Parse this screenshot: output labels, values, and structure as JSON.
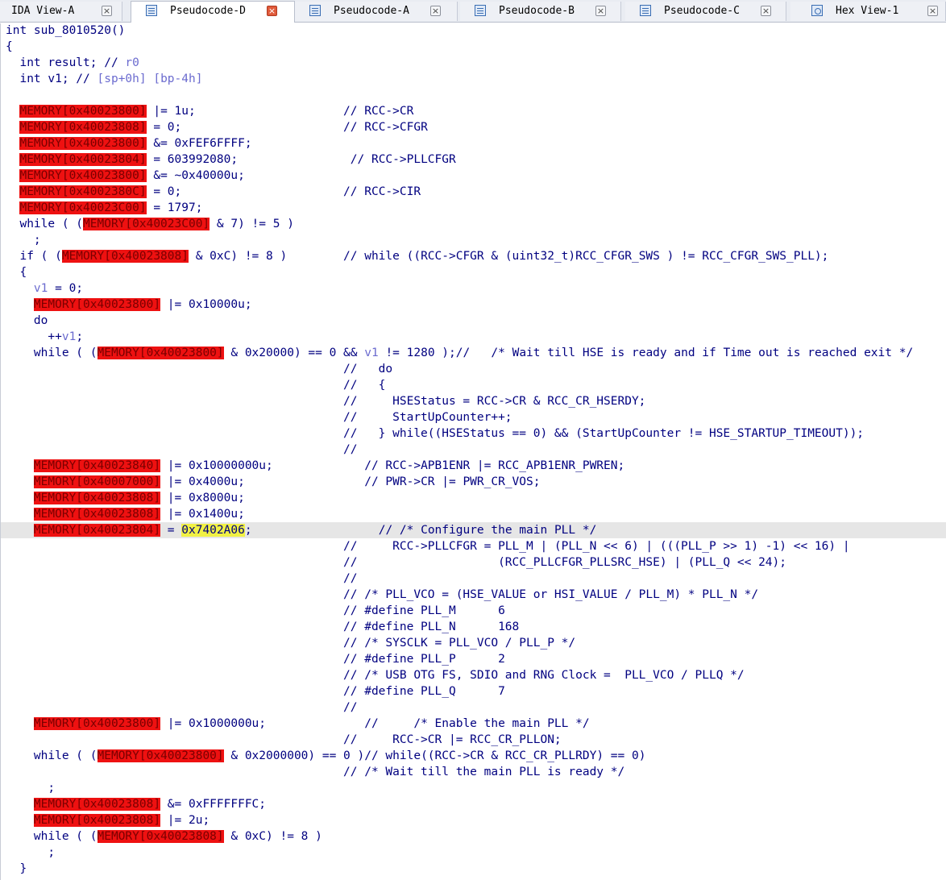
{
  "tabs": [
    {
      "label": "IDA View-A",
      "icon": "none",
      "active": false
    },
    {
      "label": "Pseudocode-D",
      "icon": "pseudocode-icon",
      "active": true
    },
    {
      "label": "Pseudocode-A",
      "icon": "pseudocode-icon",
      "active": false
    },
    {
      "label": "Pseudocode-B",
      "icon": "pseudocode-icon",
      "active": false
    },
    {
      "label": "Pseudocode-C",
      "icon": "pseudocode-icon",
      "active": false
    },
    {
      "label": "Hex View-1",
      "icon": "hex-view-icon",
      "active": false
    }
  ],
  "close_glyph": "×",
  "lines": [
    {
      "current": false,
      "segs": [
        {
          "t": "int sub_8010520()",
          "c": "t"
        }
      ]
    },
    {
      "current": false,
      "segs": [
        {
          "t": "{",
          "c": "t"
        }
      ]
    },
    {
      "current": false,
      "segs": [
        {
          "t": "  int result; // ",
          "c": "t"
        },
        {
          "t": "r0",
          "c": "var"
        }
      ]
    },
    {
      "current": false,
      "segs": [
        {
          "t": "  int v1; // ",
          "c": "t"
        },
        {
          "t": "[sp+0h] [bp-4h]",
          "c": "var"
        }
      ]
    },
    {
      "current": false,
      "segs": []
    },
    {
      "current": false,
      "segs": [
        {
          "t": "  ",
          "c": "t"
        },
        {
          "t": "MEMORY[0x40023800]",
          "c": "mem"
        },
        {
          "t": " |= 1u;                     // RCC->CR",
          "c": "t"
        }
      ]
    },
    {
      "current": false,
      "segs": [
        {
          "t": "  ",
          "c": "t"
        },
        {
          "t": "MEMORY[0x40023808]",
          "c": "mem"
        },
        {
          "t": " = 0;                       // RCC->CFGR",
          "c": "t"
        }
      ]
    },
    {
      "current": false,
      "segs": [
        {
          "t": "  ",
          "c": "t"
        },
        {
          "t": "MEMORY[0x40023800]",
          "c": "mem"
        },
        {
          "t": " &= 0xFEF6FFFF;",
          "c": "t"
        }
      ]
    },
    {
      "current": false,
      "segs": [
        {
          "t": "  ",
          "c": "t"
        },
        {
          "t": "MEMORY[0x40023804]",
          "c": "mem"
        },
        {
          "t": " = 603992080;                // RCC->PLLCFGR",
          "c": "t"
        }
      ]
    },
    {
      "current": false,
      "segs": [
        {
          "t": "  ",
          "c": "t"
        },
        {
          "t": "MEMORY[0x40023800]",
          "c": "mem"
        },
        {
          "t": " &= ~0x40000u;",
          "c": "t"
        }
      ]
    },
    {
      "current": false,
      "segs": [
        {
          "t": "  ",
          "c": "t"
        },
        {
          "t": "MEMORY[0x4002380C]",
          "c": "mem"
        },
        {
          "t": " = 0;                       // RCC->CIR",
          "c": "t"
        }
      ]
    },
    {
      "current": false,
      "segs": [
        {
          "t": "  ",
          "c": "t"
        },
        {
          "t": "MEMORY[0x40023C00]",
          "c": "mem"
        },
        {
          "t": " = 1797;",
          "c": "t"
        }
      ]
    },
    {
      "current": false,
      "segs": [
        {
          "t": "  while ( (",
          "c": "t"
        },
        {
          "t": "MEMORY[0x40023C00]",
          "c": "mem"
        },
        {
          "t": " & 7) != 5 )",
          "c": "t"
        }
      ]
    },
    {
      "current": false,
      "segs": [
        {
          "t": "    ;",
          "c": "t"
        }
      ]
    },
    {
      "current": false,
      "segs": [
        {
          "t": "  if ( (",
          "c": "t"
        },
        {
          "t": "MEMORY[0x40023808]",
          "c": "mem"
        },
        {
          "t": " & 0xC) != 8 )        // while ((RCC->CFGR & (uint32_t)RCC_CFGR_SWS ) != RCC_CFGR_SWS_PLL);",
          "c": "t"
        }
      ]
    },
    {
      "current": false,
      "segs": [
        {
          "t": "  {",
          "c": "t"
        }
      ]
    },
    {
      "current": false,
      "segs": [
        {
          "t": "    ",
          "c": "t"
        },
        {
          "t": "v1",
          "c": "var"
        },
        {
          "t": " = 0;",
          "c": "t"
        }
      ]
    },
    {
      "current": false,
      "segs": [
        {
          "t": "    ",
          "c": "t"
        },
        {
          "t": "MEMORY[0x40023800]",
          "c": "mem"
        },
        {
          "t": " |= 0x10000u;",
          "c": "t"
        }
      ]
    },
    {
      "current": false,
      "segs": [
        {
          "t": "    do",
          "c": "t"
        }
      ]
    },
    {
      "current": false,
      "segs": [
        {
          "t": "      ++",
          "c": "t"
        },
        {
          "t": "v1",
          "c": "var"
        },
        {
          "t": ";",
          "c": "t"
        }
      ]
    },
    {
      "current": false,
      "segs": [
        {
          "t": "    while ( (",
          "c": "t"
        },
        {
          "t": "MEMORY[0x40023800]",
          "c": "mem"
        },
        {
          "t": " & 0x20000) == 0 && ",
          "c": "t"
        },
        {
          "t": "v1",
          "c": "var"
        },
        {
          "t": " != 1280 );//   /* Wait till HSE is ready and if Time out is reached exit */",
          "c": "t"
        }
      ]
    },
    {
      "current": false,
      "segs": [
        {
          "t": "                                                //   do",
          "c": "t"
        }
      ]
    },
    {
      "current": false,
      "segs": [
        {
          "t": "                                                //   {",
          "c": "t"
        }
      ]
    },
    {
      "current": false,
      "segs": [
        {
          "t": "                                                //     HSEStatus = RCC->CR & RCC_CR_HSERDY;",
          "c": "t"
        }
      ]
    },
    {
      "current": false,
      "segs": [
        {
          "t": "                                                //     StartUpCounter++;",
          "c": "t"
        }
      ]
    },
    {
      "current": false,
      "segs": [
        {
          "t": "                                                //   } while((HSEStatus == 0) && (StartUpCounter != HSE_STARTUP_TIMEOUT));",
          "c": "t"
        }
      ]
    },
    {
      "current": false,
      "segs": [
        {
          "t": "                                                //",
          "c": "t"
        }
      ]
    },
    {
      "current": false,
      "segs": [
        {
          "t": "    ",
          "c": "t"
        },
        {
          "t": "MEMORY[0x40023840]",
          "c": "mem"
        },
        {
          "t": " |= 0x10000000u;             // RCC->APB1ENR |= RCC_APB1ENR_PWREN;",
          "c": "t"
        }
      ]
    },
    {
      "current": false,
      "segs": [
        {
          "t": "    ",
          "c": "t"
        },
        {
          "t": "MEMORY[0x40007000]",
          "c": "mem"
        },
        {
          "t": " |= 0x4000u;                 // PWR->CR |= PWR_CR_VOS;",
          "c": "t"
        }
      ]
    },
    {
      "current": false,
      "segs": [
        {
          "t": "    ",
          "c": "t"
        },
        {
          "t": "MEMORY[0x40023808]",
          "c": "mem"
        },
        {
          "t": " |= 0x8000u;",
          "c": "t"
        }
      ]
    },
    {
      "current": false,
      "segs": [
        {
          "t": "    ",
          "c": "t"
        },
        {
          "t": "MEMORY[0x40023808]",
          "c": "mem"
        },
        {
          "t": " |= 0x1400u;",
          "c": "t"
        }
      ]
    },
    {
      "current": true,
      "segs": [
        {
          "t": "    ",
          "c": "t"
        },
        {
          "t": "MEMORY[0x40023804]",
          "c": "mem"
        },
        {
          "t": " = ",
          "c": "t"
        },
        {
          "t": "0x7402A06",
          "c": "hl"
        },
        {
          "t": ";                  // /* Configure the main PLL */",
          "c": "t"
        }
      ]
    },
    {
      "current": false,
      "segs": [
        {
          "t": "                                                //     RCC->PLLCFGR = PLL_M | (PLL_N << 6) | (((PLL_P >> 1) -1) << 16) |",
          "c": "t"
        }
      ]
    },
    {
      "current": false,
      "segs": [
        {
          "t": "                                                //                    (RCC_PLLCFGR_PLLSRC_HSE) | (PLL_Q << 24);",
          "c": "t"
        }
      ]
    },
    {
      "current": false,
      "segs": [
        {
          "t": "                                                //",
          "c": "t"
        }
      ]
    },
    {
      "current": false,
      "segs": [
        {
          "t": "                                                // /* PLL_VCO = (HSE_VALUE or HSI_VALUE / PLL_M) * PLL_N */",
          "c": "t"
        }
      ]
    },
    {
      "current": false,
      "segs": [
        {
          "t": "                                                // #define PLL_M      6",
          "c": "t"
        }
      ]
    },
    {
      "current": false,
      "segs": [
        {
          "t": "                                                // #define PLL_N      168",
          "c": "t"
        }
      ]
    },
    {
      "current": false,
      "segs": [
        {
          "t": "                                                // /* SYSCLK = PLL_VCO / PLL_P */",
          "c": "t"
        }
      ]
    },
    {
      "current": false,
      "segs": [
        {
          "t": "                                                // #define PLL_P      2",
          "c": "t"
        }
      ]
    },
    {
      "current": false,
      "segs": [
        {
          "t": "                                                // /* USB OTG FS, SDIO and RNG Clock =  PLL_VCO / PLLQ */",
          "c": "t"
        }
      ]
    },
    {
      "current": false,
      "segs": [
        {
          "t": "                                                // #define PLL_Q      7",
          "c": "t"
        }
      ]
    },
    {
      "current": false,
      "segs": [
        {
          "t": "                                                //",
          "c": "t"
        }
      ]
    },
    {
      "current": false,
      "segs": [
        {
          "t": "    ",
          "c": "t"
        },
        {
          "t": "MEMORY[0x40023800]",
          "c": "mem"
        },
        {
          "t": " |= 0x1000000u;              //     /* Enable the main PLL */",
          "c": "t"
        }
      ]
    },
    {
      "current": false,
      "segs": [
        {
          "t": "                                                //     RCC->CR |= RCC_CR_PLLON;",
          "c": "t"
        }
      ]
    },
    {
      "current": false,
      "segs": [
        {
          "t": "    while ( (",
          "c": "t"
        },
        {
          "t": "MEMORY[0x40023800]",
          "c": "mem"
        },
        {
          "t": " & 0x2000000) == 0 )// while((RCC->CR & RCC_CR_PLLRDY) == 0)",
          "c": "t"
        }
      ]
    },
    {
      "current": false,
      "segs": [
        {
          "t": "                                                // /* Wait till the main PLL is ready */",
          "c": "t"
        }
      ]
    },
    {
      "current": false,
      "segs": [
        {
          "t": "      ;",
          "c": "t"
        }
      ]
    },
    {
      "current": false,
      "segs": [
        {
          "t": "    ",
          "c": "t"
        },
        {
          "t": "MEMORY[0x40023808]",
          "c": "mem"
        },
        {
          "t": " &= 0xFFFFFFFC;",
          "c": "t"
        }
      ]
    },
    {
      "current": false,
      "segs": [
        {
          "t": "    ",
          "c": "t"
        },
        {
          "t": "MEMORY[0x40023808]",
          "c": "mem"
        },
        {
          "t": " |= 2u;",
          "c": "t"
        }
      ]
    },
    {
      "current": false,
      "segs": [
        {
          "t": "    while ( (",
          "c": "t"
        },
        {
          "t": "MEMORY[0x40023808]",
          "c": "mem"
        },
        {
          "t": " & 0xC) != 8 )",
          "c": "t"
        }
      ]
    },
    {
      "current": false,
      "segs": [
        {
          "t": "      ;",
          "c": "t"
        }
      ]
    },
    {
      "current": false,
      "segs": [
        {
          "t": "  }",
          "c": "t"
        }
      ]
    }
  ]
}
